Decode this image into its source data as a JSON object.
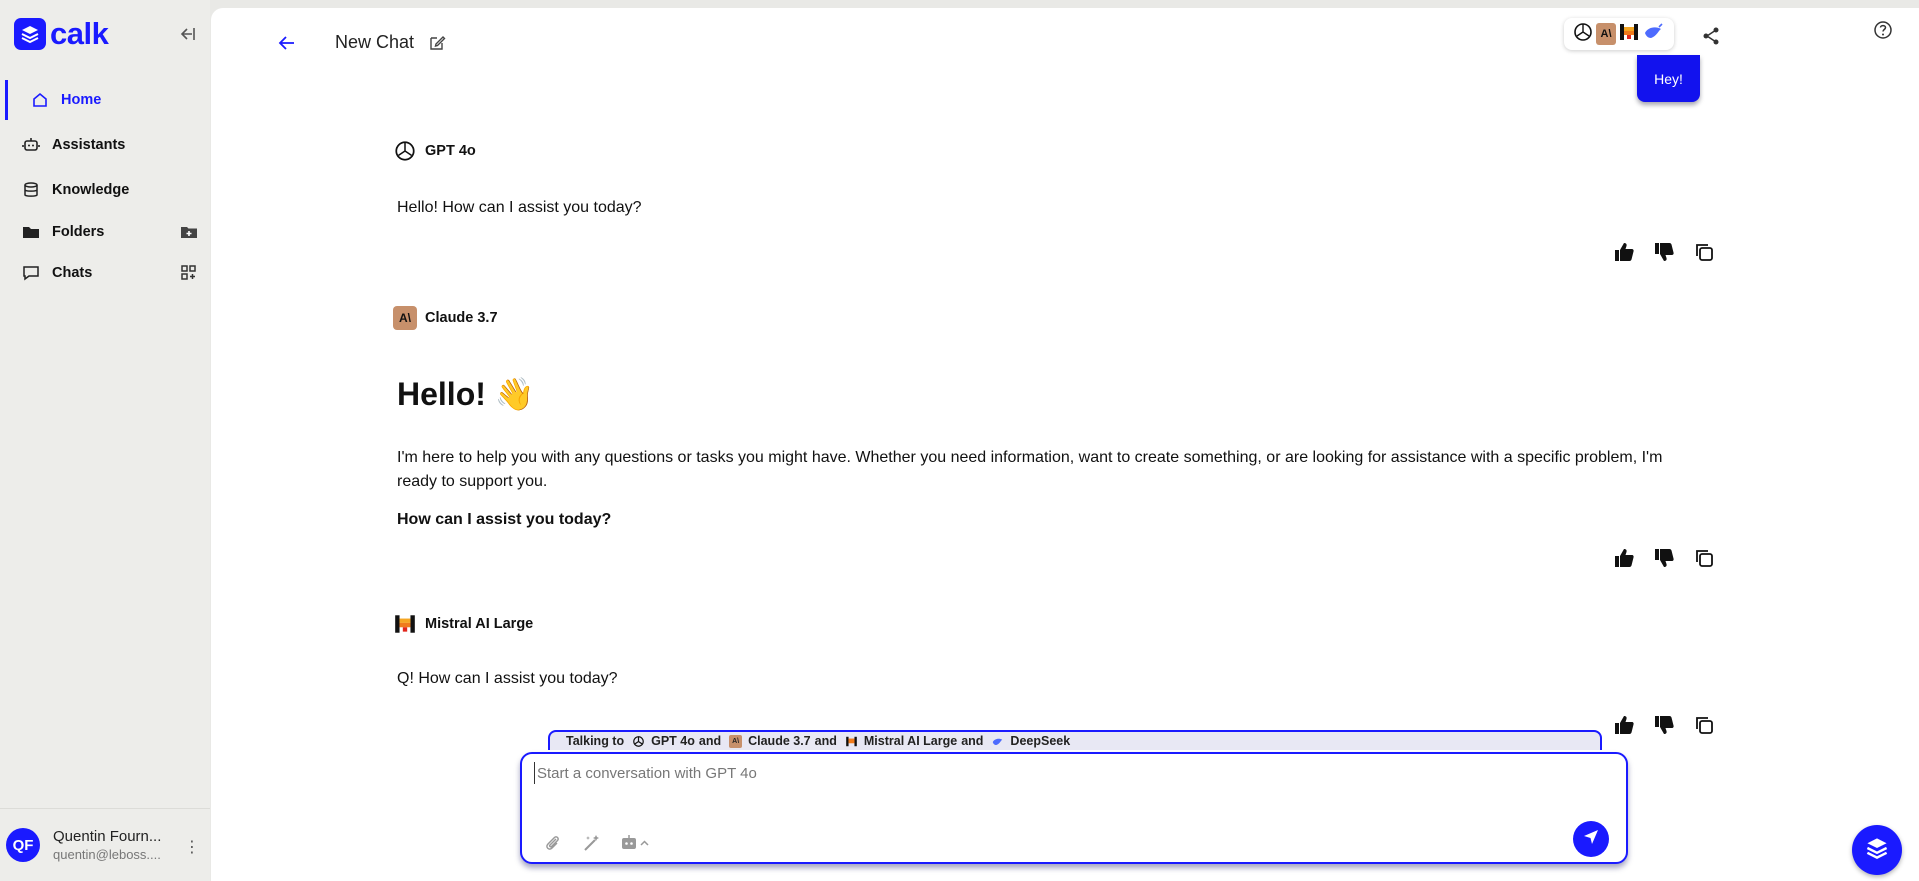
{
  "brand": {
    "name": "calk",
    "accent": "#1a1aff"
  },
  "sidebar": {
    "items": [
      {
        "label": "Home",
        "icon": "home-icon"
      },
      {
        "label": "Assistants",
        "icon": "robot-icon"
      },
      {
        "label": "Knowledge",
        "icon": "database-icon"
      },
      {
        "label": "Folders",
        "icon": "folder-icon"
      },
      {
        "label": "Chats",
        "icon": "chat-icon"
      }
    ],
    "user": {
      "initials": "QF",
      "name": "Quentin Fourn...",
      "email": "quentin@leboss...."
    }
  },
  "header": {
    "title": "New Chat"
  },
  "messages": {
    "user_message": "Hey!",
    "gpt": {
      "model": "GPT 4o",
      "text": "Hello! How can I assist you today?"
    },
    "claude": {
      "model": "Claude 3.7",
      "heading": "Hello! 👋",
      "paragraph_line1": "I'm here to help you with any questions or tasks you might have. Whether you need information, want to create something, or are looking for assistance with a specific problem, I'm",
      "paragraph_line2": "ready to support you.",
      "bold": "How can I assist you today?"
    },
    "mistral": {
      "model": "Mistral AI Large",
      "text": "Q! How can I assist you today?"
    }
  },
  "composer": {
    "talking_prefix": "Talking to",
    "talking_models": [
      "GPT 4o",
      "Claude 3.7",
      "Mistral AI Large",
      "DeepSeek"
    ],
    "talking_joiner": "and",
    "placeholder": "Start a conversation with GPT 4o"
  }
}
